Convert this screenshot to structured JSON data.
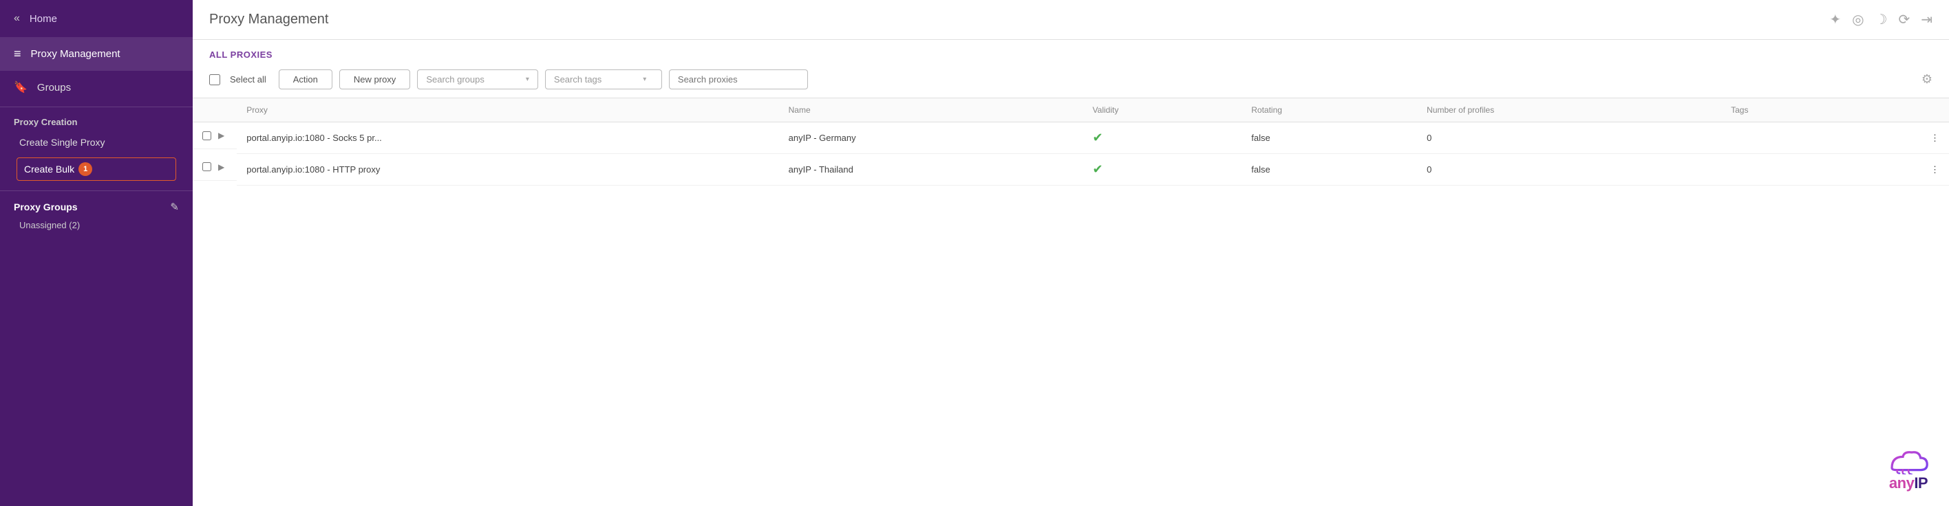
{
  "sidebar": {
    "collapse_icon": "«",
    "home_label": "Home",
    "proxy_management_label": "Proxy Management",
    "groups_label": "Groups",
    "proxy_creation_section": "Proxy Creation",
    "create_single_proxy_label": "Create Single Proxy",
    "create_bulk_label": "Create Bulk",
    "create_bulk_badge": "1",
    "proxy_groups_section": "Proxy Groups",
    "proxy_groups_edit_icon": "✎",
    "unassigned_label": "Unassigned (2)"
  },
  "header": {
    "title": "Proxy Management",
    "icons": [
      "⊕",
      "◎",
      "🌙",
      "⟳",
      "↪"
    ]
  },
  "toolbar": {
    "all_proxies_label": "ALL PROXIES",
    "select_all_label": "Select all",
    "action_label": "Action",
    "new_proxy_label": "New proxy",
    "search_groups_placeholder": "Search groups",
    "search_tags_placeholder": "Search tags",
    "search_proxies_placeholder": "Search proxies"
  },
  "table": {
    "columns": [
      "",
      "Proxy",
      "Name",
      "Validity",
      "Rotating",
      "Number of profiles",
      "Tags",
      ""
    ],
    "rows": [
      {
        "proxy": "portal.anyip.io:1080 - Socks 5 pr...",
        "name": "anyIP - Germany",
        "validity": true,
        "rotating": "false",
        "profiles": "0",
        "tags": ""
      },
      {
        "proxy": "portal.anyip.io:1080 - HTTP proxy",
        "name": "anyIP - Thailand",
        "validity": true,
        "rotating": "false",
        "profiles": "0",
        "tags": ""
      }
    ]
  },
  "logo": {
    "text_any": "any",
    "text_ip": "IP"
  }
}
